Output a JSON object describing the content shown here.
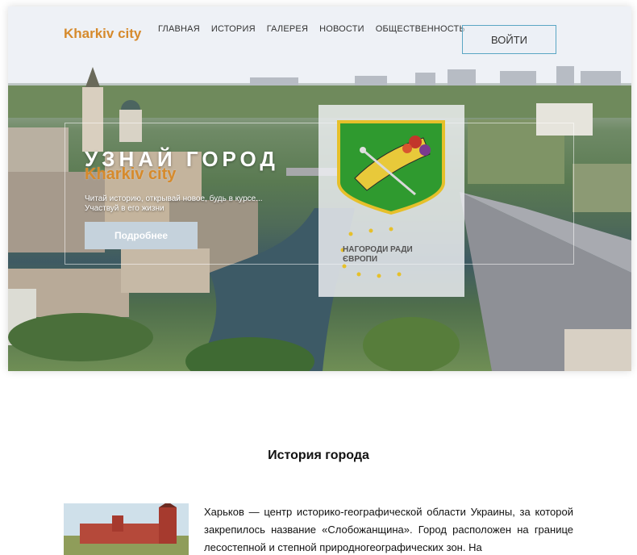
{
  "header": {
    "logo": "Kharkiv city",
    "nav": [
      "ГЛАВНАЯ",
      "ИСТОРИЯ",
      "ГАЛЕРЕЯ",
      "НОВОСТИ",
      "ОБЩЕСТВЕННОСТЬ"
    ],
    "login_label": "ВОЙТИ"
  },
  "hero": {
    "title": "УЗНАЙ ГОРОД",
    "subtitle": "Kharkiv city",
    "text": "Читай историю, открывай новое, будь в курсе... Участвуй в его жизни",
    "button_label": "Подробнее",
    "eu_badge_text": "НАГОРОДИ РАДИ ЄВРОПИ"
  },
  "history": {
    "title": "История города",
    "text": "Харьков — центр историко-географической области Украины, за которой закрепилось название «Слобожанщина». Город расположен на границе лесостепной и степной природногеографических зон. На"
  },
  "colors": {
    "accent": "#d68a2c",
    "login_border": "#5aa6c4",
    "button_bg": "#c5d2dc"
  },
  "icons": {
    "emblem": "kharkiv-coat-of-arms-icon",
    "eu_stars": "eu-stars-icon"
  }
}
